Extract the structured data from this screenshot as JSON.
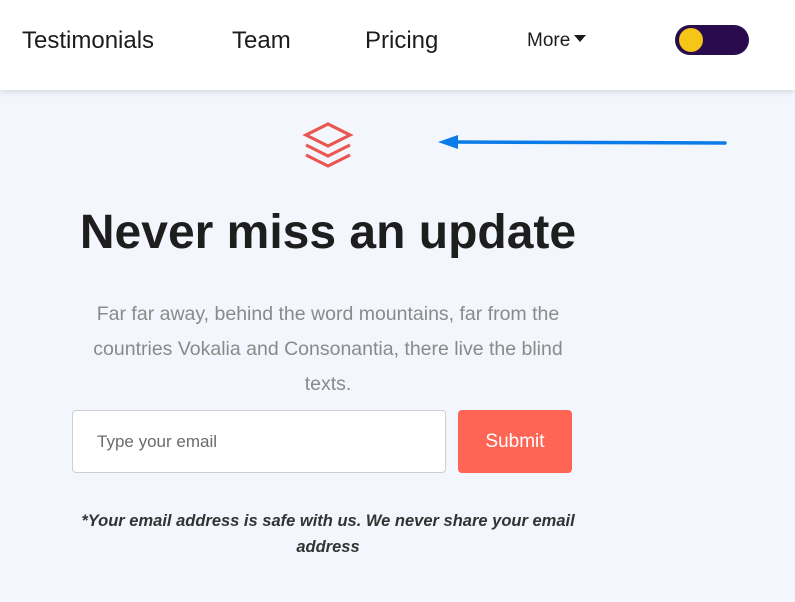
{
  "navbar": {
    "links": [
      "Testimonials",
      "Team",
      "Pricing"
    ],
    "more_label": "More",
    "theme_toggle": {
      "state": "off",
      "track_color": "#2a0b4d",
      "knob_color": "#f5c518"
    }
  },
  "hero": {
    "logo_icon": "layers-icon",
    "logo_color": "#e9574f",
    "annotation_arrow_color": "#0b7be8",
    "headline": "Never miss an update",
    "description": "Far far away, behind the word mountains, far from the countries Vokalia and Consonantia, there live the blind texts."
  },
  "subscribe_form": {
    "email_placeholder": "Type your email",
    "email_value": "",
    "submit_label": "Submit",
    "submit_color": "#fe6555",
    "disclaimer": "*Your email address is safe with us. We never share your email address"
  }
}
